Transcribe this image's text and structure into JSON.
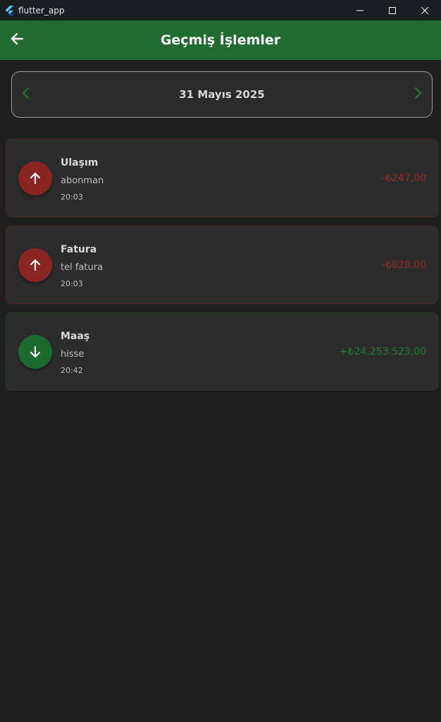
{
  "window": {
    "title": "flutter_app",
    "icon": "flutter-logo-icon",
    "controls": [
      "minimize-icon",
      "maximize-icon",
      "close-icon"
    ]
  },
  "appbar": {
    "title": "Geçmiş İşlemler",
    "back_icon": "arrow-left-icon",
    "color": "#1f6b30"
  },
  "date_selector": {
    "date": "31 Mayıs 2025",
    "prev_icon": "chevron-left-icon",
    "next_icon": "chevron-right-icon"
  },
  "transactions": [
    {
      "type": "expense",
      "icon": "arrow-up-icon",
      "category": "Ulaşım",
      "description": "abonman",
      "time": "20:03",
      "amount": "-₺247,00"
    },
    {
      "type": "expense",
      "icon": "arrow-up-icon",
      "category": "Fatura",
      "description": "tel fatura",
      "time": "20:03",
      "amount": "-₺828,00"
    },
    {
      "type": "income",
      "icon": "arrow-down-icon",
      "category": "Maaş",
      "description": "hisse",
      "time": "20:42",
      "amount": "+₺24.253.523,00"
    }
  ],
  "colors": {
    "expense": "#8a2422",
    "income": "#1d6a2f",
    "background": "#1f1f1f"
  }
}
